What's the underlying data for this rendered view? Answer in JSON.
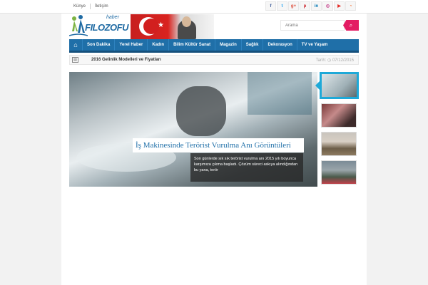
{
  "topbar": {
    "links": [
      "Künye",
      "İletişim"
    ],
    "social": [
      {
        "icon": "facebook-icon",
        "glyph": "f",
        "color": "#3b5998"
      },
      {
        "icon": "twitter-icon",
        "glyph": "t",
        "color": "#1da1f2"
      },
      {
        "icon": "google-plus-icon",
        "glyph": "g+",
        "color": "#dd4b39"
      },
      {
        "icon": "pinterest-icon",
        "glyph": "p",
        "color": "#cb2027"
      },
      {
        "icon": "linkedin-icon",
        "glyph": "in",
        "color": "#0077b5"
      },
      {
        "icon": "instagram-icon",
        "glyph": "◎",
        "color": "#c13584"
      },
      {
        "icon": "youtube-icon",
        "glyph": "▶",
        "color": "#e52d27"
      },
      {
        "icon": "rss-icon",
        "glyph": "◔",
        "color": "#f26522"
      }
    ]
  },
  "logo": {
    "small": "haber",
    "name": "FILOZOFU"
  },
  "search": {
    "placeholder": "Arama",
    "icon": "search-icon"
  },
  "nav": {
    "home_icon": "home-icon",
    "items": [
      "Son Dakika",
      "Yerel Haber",
      "Kadın",
      "Bilim Kültür Sanat",
      "Magazin",
      "Sağlık",
      "Dekorasyon",
      "TV ve Yaşam"
    ]
  },
  "ticker": {
    "headline": "2016 Gelinlik Modelleri ve Fiyatları",
    "date_label": "Tarih:",
    "date": "07/12/2015"
  },
  "slider": {
    "title": "İş Makinesinde Terörist Vurulma Anı Görüntüleri",
    "description": "Son günlerde sık sık terörist vurulma anı 2015 yılı boyunca karşımıza çıkma başladı. Çözüm süreci askıya alındığından bu yana, terör"
  },
  "colors": {
    "accent": "#1f6fa8",
    "search_button": "#e31c63",
    "thumb_active": "#1ea9d8"
  }
}
